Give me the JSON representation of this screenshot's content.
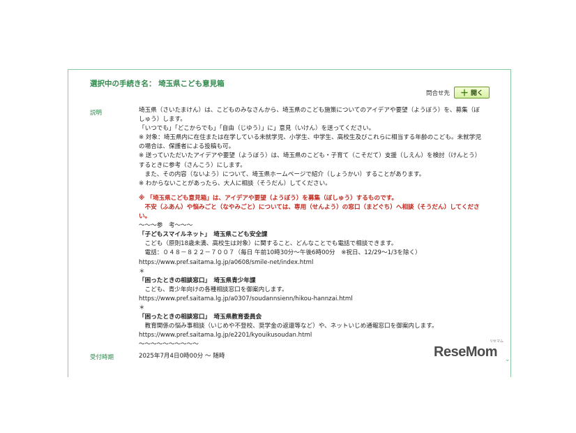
{
  "procedure": {
    "title": "選択中の手続き名： 埼玉県こども意見箱"
  },
  "contact": {
    "label": "問合せ先",
    "open_button_icon": "plus-icon",
    "open_button_plus": "＋",
    "open_button_label": "開く"
  },
  "description": {
    "label": "説明",
    "lines": [
      "埼玉県（さいたまけん）は、こどものみなさんから、埼玉県のこども施策についてのアイデアや要望（ようぼう）を、募集（ぼ",
      "しゅう）します。",
      "「いつでも」「どこからでも」「自由（じゆう）」に」意見（いけん）を送ってください。",
      "※ 対象：埼玉県内に在住または在学している未就学児、小学生、中学生、高校生及びこれらに相当する年齢のこども。未就学児",
      "の場合は、保護者による投稿も可。",
      "※ 送っていただいたアイデアや要望（ようぼう）は、埼玉県のこども・子育て（こそだて）支援（しえん）を検討（けんとう）",
      "するときに参考（さんこう）にします。",
      "　また、その内容（ないよう）について、埼玉県ホームページで紹介（しょうかい）することがあります。",
      "※ わからないことがあったら、大人に相談（そうだん）してください。",
      "※ 「埼玉県こども意見箱」は、アイデアや要望（ようぼう）を募集（ぼしゅう）するものです。",
      "　不安（ふあん）や悩みごと（なやみごと）については、専用（せんよう）の窓口（まどぐち）へ相談（そうだん）してくださ",
      "い。",
      "〜〜〜参　考〜〜〜",
      "「子どもスマイルネット」　埼玉県こども安全課",
      "　こども（原則18歳未満、高校生は対象）に関すること、どんなことでも電話で相談できます。",
      "　電話：０４８－８２２－７００７（毎日 午前10時30分〜午後6時00分　※祝日、12/29〜1/3を除く）",
      "https://www.pref.saitama.lg.jp/a0608/smile-net/index.html",
      "＊",
      "「困ったときの相談窓口」　埼玉県青少年課",
      "　こども、青少年向けの各種相談窓口を御案内します。",
      "https://www.pref.saitama.lg.jp/a0307/soudannsienn/hikou-hannzai.html",
      "＊",
      "「困ったときの相談窓口」　埼玉県教育委員会",
      "　教育関係の悩み事相談（いじめや不登校、奨学金の返還等など）や、ネットいじめ通報窓口を御案内します。",
      "https://www.pref.saitama.lg.jp/e2201/kyouikusoudan.html",
      "〜〜〜〜〜〜〜〜〜〜"
    ]
  },
  "reception": {
    "label": "受付時期",
    "value": "2025年7月4日0時00分 〜 随時"
  },
  "logo": {
    "text": "ReseMom",
    "ruby": "リセマム"
  },
  "colors": {
    "accent_green": "#2f8a4c",
    "border_green": "#8cc9a3",
    "warning_red": "#c0281e",
    "button_green": "#d7f0a4"
  }
}
